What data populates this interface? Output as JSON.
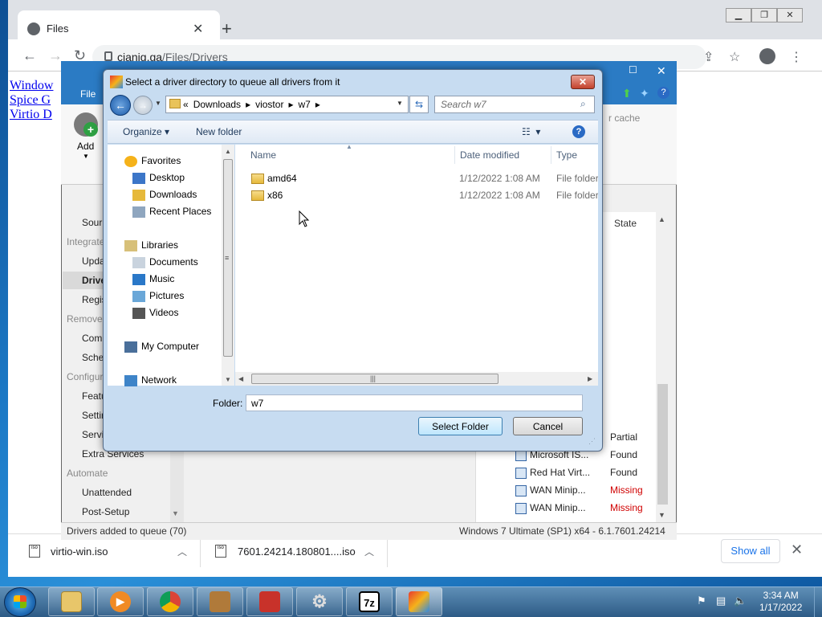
{
  "browser": {
    "tab_title": "Files",
    "url_host": "cianig.ga",
    "url_path": "/Files/Drivers",
    "page_links": [
      "Window",
      "Spice G",
      "Virtio D"
    ]
  },
  "downloads": {
    "items": [
      "virtio-win.iso",
      "7601.24214.180801....iso"
    ],
    "show_all": "Show all"
  },
  "ntlite": {
    "menu_file": "File",
    "ribbon_add": "Add",
    "ribbon_cache": "r cache",
    "sidebar": [
      {
        "label": "Sour",
        "kind": "item"
      },
      {
        "label": "Integrate",
        "kind": "head"
      },
      {
        "label": "Upda",
        "kind": "item"
      },
      {
        "label": "Drive",
        "kind": "selected"
      },
      {
        "label": "Regis",
        "kind": "item"
      },
      {
        "label": "Remove",
        "kind": "head"
      },
      {
        "label": "Com",
        "kind": "item"
      },
      {
        "label": "Sche",
        "kind": "item"
      },
      {
        "label": "Configure",
        "kind": "head"
      },
      {
        "label": "Featu",
        "kind": "item"
      },
      {
        "label": "Settir",
        "kind": "item"
      },
      {
        "label": "Servi",
        "kind": "item"
      },
      {
        "label": "Extra Services",
        "kind": "item"
      },
      {
        "label": "Automate",
        "kind": "head"
      },
      {
        "label": "Unattended",
        "kind": "item"
      },
      {
        "label": "Post-Setup",
        "kind": "item"
      }
    ],
    "list_header_state": "State",
    "rows": [
      {
        "name": "",
        "state": "Partial",
        "color": "#222222"
      },
      {
        "name": "Microsoft IS...",
        "state": "Found",
        "color": "#222222"
      },
      {
        "name": "Red Hat Virt...",
        "state": "Found",
        "color": "#222222"
      },
      {
        "name": "WAN Minip...",
        "state": "Missing",
        "color": "#d00000"
      },
      {
        "name": "WAN Minip...",
        "state": "Missing",
        "color": "#d00000"
      }
    ],
    "status_left": "Drivers added to queue (70)",
    "status_right": "Windows 7 Ultimate (SP1) x64 - 6.1.7601.24214"
  },
  "dialog": {
    "title": "Select a driver directory to queue all drivers from it",
    "breadcrumb": [
      "«",
      "Downloads",
      "▸",
      "viostor",
      "▸",
      "w7",
      "▸"
    ],
    "search_placeholder": "Search w7",
    "organize": "Organize ▾",
    "new_folder": "New folder",
    "nav": [
      {
        "label": "Favorites",
        "icon": "star-icon",
        "indent": 0
      },
      {
        "label": "Desktop",
        "icon": "desktop-icon",
        "indent": 1
      },
      {
        "label": "Downloads",
        "icon": "downloads-folder-icon",
        "indent": 1
      },
      {
        "label": "Recent Places",
        "icon": "recent-places-icon",
        "indent": 1
      },
      {
        "label": "Libraries",
        "icon": "libraries-icon",
        "indent": 0
      },
      {
        "label": "Documents",
        "icon": "documents-icon",
        "indent": 1
      },
      {
        "label": "Music",
        "icon": "music-icon",
        "indent": 1
      },
      {
        "label": "Pictures",
        "icon": "pictures-icon",
        "indent": 1
      },
      {
        "label": "Videos",
        "icon": "videos-icon",
        "indent": 1
      },
      {
        "label": "My Computer",
        "icon": "computer-icon",
        "indent": 0
      },
      {
        "label": "Network",
        "icon": "network-icon",
        "indent": 0
      }
    ],
    "columns": [
      "Name",
      "Date modified",
      "Type"
    ],
    "files": [
      {
        "name": "amd64",
        "date": "1/12/2022 1:08 AM",
        "type": "File folder"
      },
      {
        "name": "x86",
        "date": "1/12/2022 1:08 AM",
        "type": "File folder"
      }
    ],
    "folder_label": "Folder:",
    "folder_value": "w7",
    "select_button": "Select Folder",
    "cancel_button": "Cancel"
  },
  "taskbar": {
    "time": "3:34 AM",
    "date": "1/17/2022",
    "apps": [
      "explorer",
      "media-player",
      "chrome",
      "toolbox",
      "app-red",
      "settings-gear",
      "7zip",
      "ntlite"
    ]
  }
}
